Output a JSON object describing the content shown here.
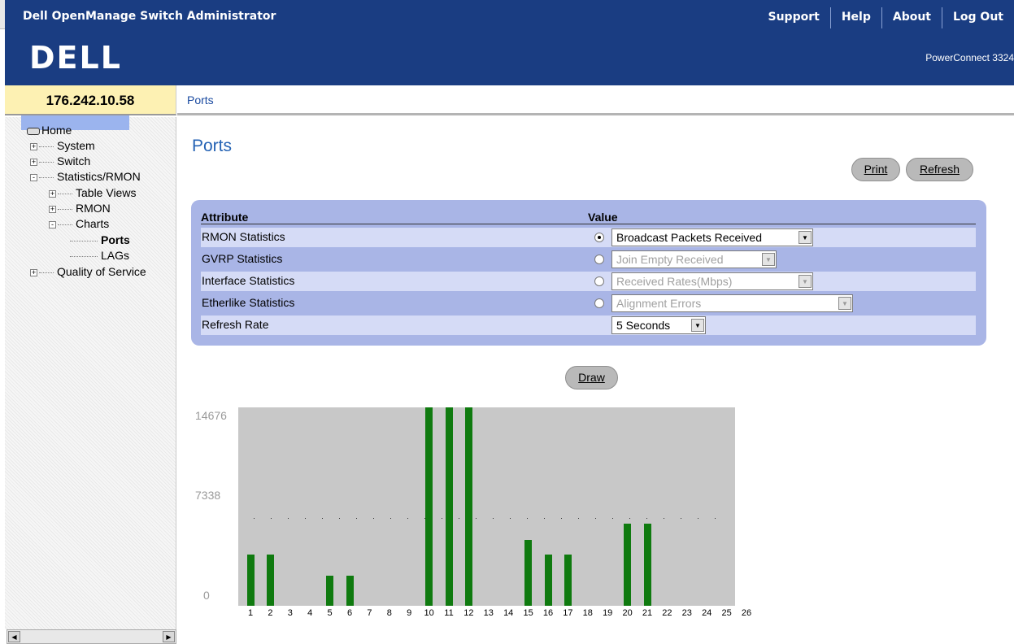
{
  "header": {
    "app_title": "Dell OpenManage Switch Administrator",
    "nav": [
      "Support",
      "Help",
      "About",
      "Log Out"
    ]
  },
  "brand": {
    "logo": "DELL",
    "model": "PowerConnect 3324"
  },
  "device_ip": "176.242.10.58",
  "tree": {
    "home": "Home",
    "items": [
      {
        "label": "System",
        "expander": "+"
      },
      {
        "label": "Switch",
        "expander": "+"
      },
      {
        "label": "Statistics/RMON",
        "expander": "-"
      },
      {
        "label": "Table Views",
        "expander": "+"
      },
      {
        "label": "RMON",
        "expander": "+"
      },
      {
        "label": "Charts",
        "expander": "-"
      },
      {
        "label": "Ports",
        "selected": true
      },
      {
        "label": "LAGs"
      },
      {
        "label": "Quality of Service",
        "expander": "+"
      }
    ]
  },
  "breadcrumb": "Ports",
  "page_title": "Ports",
  "buttons": {
    "print": "Print",
    "refresh": "Refresh",
    "draw": "Draw"
  },
  "attributes": {
    "header_attribute": "Attribute",
    "header_value": "Value",
    "rows": [
      {
        "label": "RMON Statistics",
        "radio_selected": true,
        "value": "Broadcast Packets Received",
        "enabled": true
      },
      {
        "label": "GVRP Statistics",
        "radio_selected": false,
        "value": "Join Empty Received",
        "enabled": false
      },
      {
        "label": "Interface Statistics",
        "radio_selected": false,
        "value": "Received Rates(Mbps)",
        "enabled": false
      },
      {
        "label": "Etherlike Statistics",
        "radio_selected": false,
        "value": "Alignment Errors",
        "enabled": false
      },
      {
        "label": "Refresh Rate",
        "value": "5 Seconds",
        "enabled": true
      }
    ]
  },
  "chart_data": {
    "type": "bar",
    "y_ticks": [
      "14676",
      "7338",
      "0"
    ],
    "ylim": [
      0,
      14676
    ],
    "categories": [
      "1",
      "2",
      "3",
      "4",
      "5",
      "6",
      "7",
      "8",
      "9",
      "10",
      "11",
      "12",
      "13",
      "14",
      "15",
      "16",
      "17",
      "18",
      "19",
      "20",
      "21",
      "22",
      "23",
      "24",
      "25",
      "26"
    ],
    "values": [
      3800,
      3800,
      0,
      0,
      2200,
      2200,
      0,
      0,
      0,
      14676,
      14676,
      14676,
      0,
      0,
      4900,
      3800,
      3800,
      0,
      0,
      6100,
      6100,
      0,
      0,
      0,
      0,
      0
    ],
    "bar_color": "#0f7a0f",
    "background": "#c8c8c8"
  }
}
